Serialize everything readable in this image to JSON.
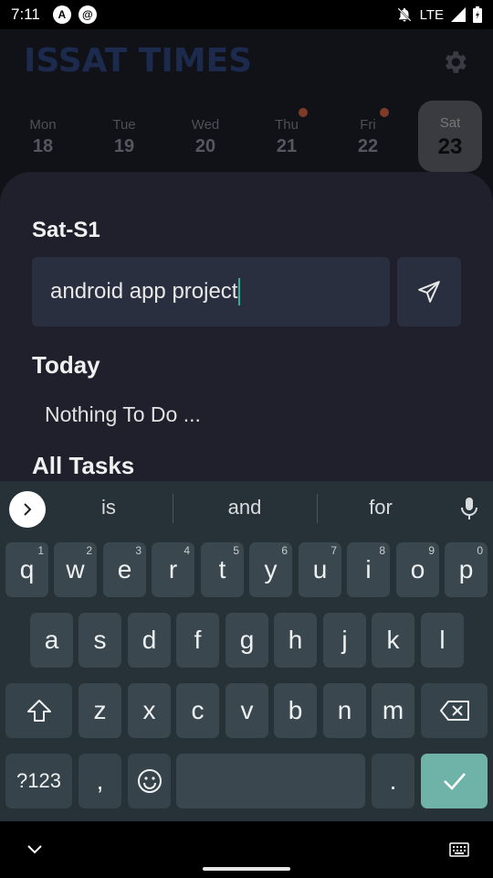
{
  "status_bar": {
    "time": "7:11",
    "network": "LTE"
  },
  "app": {
    "title": "ISSAT TIMES",
    "week": [
      {
        "name": "Mon",
        "date": "18",
        "has_dot": false,
        "selected": false
      },
      {
        "name": "Tue",
        "date": "19",
        "has_dot": false,
        "selected": false
      },
      {
        "name": "Wed",
        "date": "20",
        "has_dot": false,
        "selected": false
      },
      {
        "name": "Thu",
        "date": "21",
        "has_dot": true,
        "selected": false
      },
      {
        "name": "Fri",
        "date": "22",
        "has_dot": true,
        "selected": false
      },
      {
        "name": "Sat",
        "date": "23",
        "has_dot": false,
        "selected": true
      }
    ]
  },
  "sheet": {
    "title": "Sat-S1",
    "input_value": "android app project",
    "today_heading": "Today",
    "empty_text": "Nothing To Do ...",
    "all_tasks_heading": "All Tasks"
  },
  "keyboard": {
    "suggestions": [
      "is",
      "and",
      "for"
    ],
    "row1": [
      {
        "k": "q",
        "h": "1"
      },
      {
        "k": "w",
        "h": "2"
      },
      {
        "k": "e",
        "h": "3"
      },
      {
        "k": "r",
        "h": "4"
      },
      {
        "k": "t",
        "h": "5"
      },
      {
        "k": "y",
        "h": "6"
      },
      {
        "k": "u",
        "h": "7"
      },
      {
        "k": "i",
        "h": "8"
      },
      {
        "k": "o",
        "h": "9"
      },
      {
        "k": "p",
        "h": "0"
      }
    ],
    "row2": [
      "a",
      "s",
      "d",
      "f",
      "g",
      "h",
      "j",
      "k",
      "l"
    ],
    "row3": [
      "z",
      "x",
      "c",
      "v",
      "b",
      "n",
      "m"
    ],
    "symbols_label": "?123",
    "comma": ",",
    "period": "."
  },
  "colors": {
    "accent": "#6fb3a8",
    "caret": "#2bb39a",
    "sheet": "#201f2c",
    "keyboard": "#263238"
  }
}
